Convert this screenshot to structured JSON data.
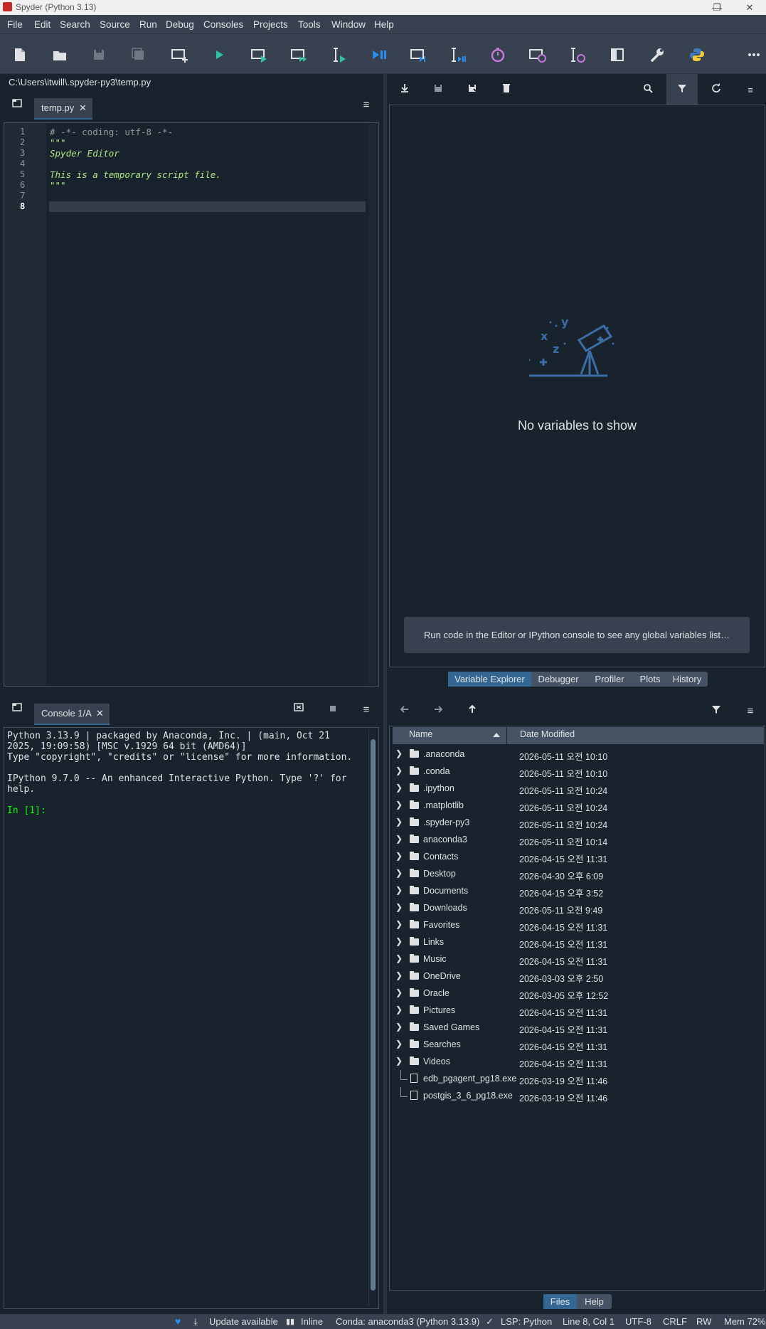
{
  "window": {
    "title": "Spyder (Python 3.13)",
    "minimize": "—",
    "restore": "❐",
    "close": "✕"
  },
  "menu": [
    "File",
    "Edit",
    "Search",
    "Source",
    "Run",
    "Debug",
    "Consoles",
    "Projects",
    "Tools",
    "Window",
    "Help"
  ],
  "toolbar": {
    "icons": [
      "new-file",
      "open-file",
      "save",
      "save-all",
      "new-cell",
      "run",
      "run-cell",
      "run-cell-advance",
      "run-selection",
      "debug",
      "debug-cell",
      "debug-selection",
      "profile",
      "profile-cell",
      "profile-selection",
      "maximize-pane",
      "preferences",
      "python-path",
      "more"
    ]
  },
  "path": "C:\\Users\\itwill\\.spyder-py3\\temp.py",
  "editor": {
    "tab_label": "temp.py",
    "close_glyph": "✕",
    "line_numbers": [
      "1",
      "2",
      "3",
      "4",
      "5",
      "6",
      "7",
      "8"
    ],
    "lines": [
      "# -*- coding: utf-8 -*-",
      "\"\"\"",
      "Spyder Editor",
      "",
      "This is a temporary script file.",
      "\"\"\"",
      "",
      ""
    ],
    "current_line": 8
  },
  "variable_explorer": {
    "empty_text": "No variables to show",
    "hint": "Run code in the Editor or IPython console to see any global variables list…",
    "tabs": [
      "Variable Explorer",
      "Debugger",
      "Profiler",
      "Plots",
      "History"
    ],
    "active_tab": "Variable Explorer"
  },
  "console": {
    "tab_label": "Console 1/A",
    "lines": [
      "Python 3.13.9 | packaged by Anaconda, Inc. | (main, Oct 21",
      "2025, 19:09:58) [MSC v.1929 64 bit (AMD64)]",
      "Type \"copyright\", \"credits\" or \"license\" for more information.",
      "",
      "IPython 9.7.0 -- An enhanced Interactive Python. Type '?' for",
      "help.",
      "",
      "In [1]:"
    ],
    "prompt_color": "#00ff00"
  },
  "files": {
    "col_name": "Name",
    "col_date": "Date Modified",
    "rows": [
      {
        "name": ".anaconda",
        "date": "2026-05-11 오전 10:10",
        "type": "folder"
      },
      {
        "name": ".conda",
        "date": "2026-05-11 오전 10:10",
        "type": "folder"
      },
      {
        "name": ".ipython",
        "date": "2026-05-11 오전 10:24",
        "type": "folder"
      },
      {
        "name": ".matplotlib",
        "date": "2026-05-11 오전 10:24",
        "type": "folder"
      },
      {
        "name": ".spyder-py3",
        "date": "2026-05-11 오전 10:24",
        "type": "folder"
      },
      {
        "name": "anaconda3",
        "date": "2026-05-11 오전 10:14",
        "type": "folder"
      },
      {
        "name": "Contacts",
        "date": "2026-04-15 오전 11:31",
        "type": "folder"
      },
      {
        "name": "Desktop",
        "date": "2026-04-30 오후 6:09",
        "type": "folder"
      },
      {
        "name": "Documents",
        "date": "2026-04-15 오후 3:52",
        "type": "folder"
      },
      {
        "name": "Downloads",
        "date": "2026-05-11 오전 9:49",
        "type": "folder"
      },
      {
        "name": "Favorites",
        "date": "2026-04-15 오전 11:31",
        "type": "folder"
      },
      {
        "name": "Links",
        "date": "2026-04-15 오전 11:31",
        "type": "folder"
      },
      {
        "name": "Music",
        "date": "2026-04-15 오전 11:31",
        "type": "folder"
      },
      {
        "name": "OneDrive",
        "date": "2026-03-03 오후 2:50",
        "type": "folder"
      },
      {
        "name": "Oracle",
        "date": "2026-03-05 오후 12:52",
        "type": "folder"
      },
      {
        "name": "Pictures",
        "date": "2026-04-15 오전 11:31",
        "type": "folder"
      },
      {
        "name": "Saved Games",
        "date": "2026-04-15 오전 11:31",
        "type": "folder"
      },
      {
        "name": "Searches",
        "date": "2026-04-15 오전 11:31",
        "type": "folder"
      },
      {
        "name": "Videos",
        "date": "2026-04-15 오전 11:31",
        "type": "folder"
      },
      {
        "name": "edb_pgagent_pg18.exe",
        "date": "2026-03-19 오전 11:46",
        "type": "file"
      },
      {
        "name": "postgis_3_6_pg18.exe",
        "date": "2026-03-19 오전 11:46",
        "type": "file"
      }
    ],
    "tabs": [
      "Files",
      "Help"
    ],
    "active_tab": "Files"
  },
  "status": {
    "update": "Update available",
    "inline": "Inline",
    "conda": "Conda: anaconda3 (Python 3.13.9)",
    "lsp": "LSP: Python",
    "position": "Line 8, Col 1",
    "encoding": "UTF-8",
    "eol": "CRLF",
    "mode": "RW",
    "mem": "Mem 72%"
  },
  "colors": {
    "accent": "#346792",
    "bg": "#19232d",
    "toolbar": "#37414f",
    "comment": "#999999",
    "string": "#b0e686",
    "prompt": "#00ff00"
  }
}
